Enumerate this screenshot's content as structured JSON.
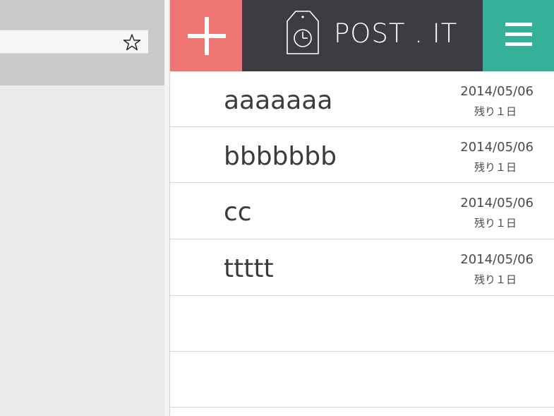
{
  "browser": {
    "address_value": "",
    "bookmark_icon": "star-icon"
  },
  "header": {
    "title": "POST . IT",
    "add_icon": "plus-icon",
    "menu_icon": "hamburger-menu-icon",
    "logo_icon": "tag-clock-icon",
    "colors": {
      "header_bg": "#3d3c42",
      "add_bg": "#ef7572",
      "menu_bg": "#35b19a"
    }
  },
  "posts": [
    {
      "title": "aaaaaaa",
      "date": "2014/05/06",
      "remaining": "残り１日"
    },
    {
      "title": "bbbbbbb",
      "date": "2014/05/06",
      "remaining": "残り１日"
    },
    {
      "title": "cc",
      "date": "2014/05/06",
      "remaining": "残り１日"
    },
    {
      "title": "ttttt",
      "date": "2014/05/06",
      "remaining": "残り１日"
    }
  ]
}
